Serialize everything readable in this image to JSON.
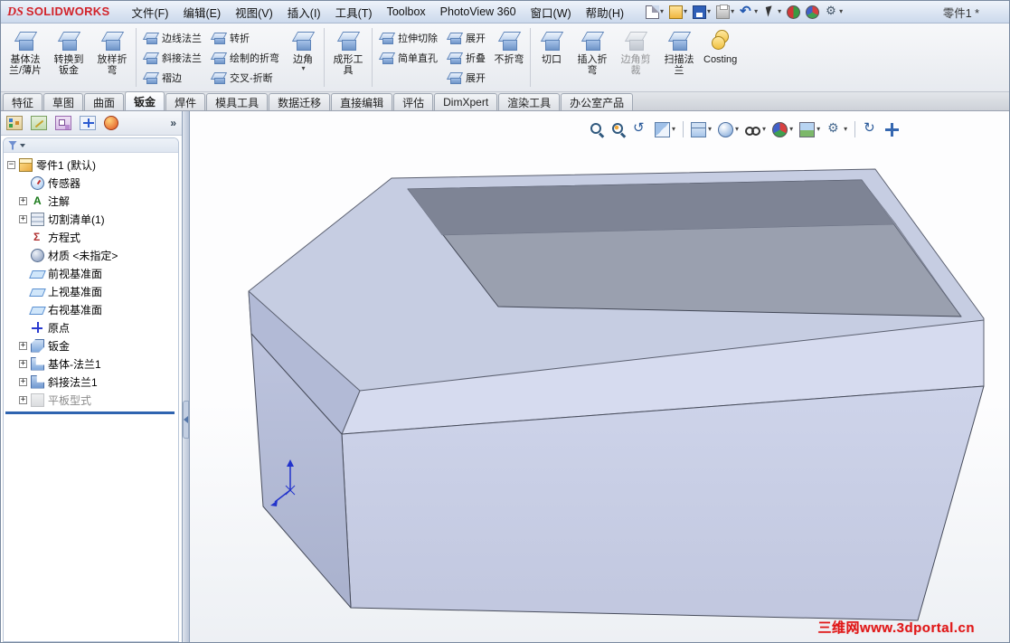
{
  "colors": {
    "brand_red": "#d2232a",
    "rollback_blue": "#2f64b0",
    "watermark_red": "#e01818",
    "model_face": "#c7cde5"
  },
  "titlebar": {
    "logo_ds": "DS",
    "logo_text": "SOLIDWORKS",
    "menus": [
      "文件(F)",
      "编辑(E)",
      "视图(V)",
      "插入(I)",
      "工具(T)",
      "Toolbox",
      "PhotoView 360",
      "窗口(W)",
      "帮助(H)"
    ],
    "doc_title": "零件1 *",
    "quick_tools": [
      {
        "name": "new",
        "dd": true
      },
      {
        "name": "open",
        "dd": true
      },
      {
        "name": "save",
        "dd": true
      },
      {
        "name": "print",
        "dd": true
      },
      {
        "name": "undo",
        "dd": true
      },
      {
        "name": "select",
        "dd": true
      },
      {
        "name": "rebuild",
        "dd": false
      },
      {
        "name": "appearance",
        "dd": false
      },
      {
        "name": "options",
        "dd": true
      }
    ]
  },
  "ribbon": {
    "items": [
      {
        "kind": "large",
        "label": "基体法兰/薄片",
        "icon": "base-flange"
      },
      {
        "kind": "large",
        "label": "转换到钣金",
        "icon": "convert-to-sheet-metal"
      },
      {
        "kind": "large",
        "label": "放样折弯",
        "icon": "lofted-bend"
      },
      {
        "kind": "sep"
      },
      {
        "kind": "col",
        "buttons": [
          {
            "label": "边线法兰",
            "icon": "edge-flange"
          },
          {
            "label": "斜接法兰",
            "icon": "miter-flange"
          },
          {
            "label": "褶边",
            "icon": "hem"
          }
        ]
      },
      {
        "kind": "col",
        "buttons": [
          {
            "label": "转折",
            "icon": "jog"
          },
          {
            "label": "绘制的折弯",
            "icon": "sketched-bend"
          },
          {
            "label": "交叉-折断",
            "icon": "cross-break"
          }
        ]
      },
      {
        "kind": "large",
        "label": "边角",
        "icon": "corner",
        "dd": true
      },
      {
        "kind": "sep"
      },
      {
        "kind": "large",
        "label": "成形工具",
        "icon": "forming-tool"
      },
      {
        "kind": "sep"
      },
      {
        "kind": "col",
        "buttons": [
          {
            "label": "拉伸切除",
            "icon": "extruded-cut"
          },
          {
            "label": "简单直孔",
            "icon": "simple-hole"
          }
        ]
      },
      {
        "kind": "col",
        "buttons": [
          {
            "label": "展开",
            "icon": "unfold"
          },
          {
            "label": "折叠",
            "icon": "fold"
          },
          {
            "label": "展开",
            "icon": "flatten"
          }
        ]
      },
      {
        "kind": "large",
        "label": "不折弯",
        "icon": "no-bends"
      },
      {
        "kind": "sep"
      },
      {
        "kind": "large",
        "label": "切口",
        "icon": "rip"
      },
      {
        "kind": "large",
        "label": "插入折弯",
        "icon": "insert-bends"
      },
      {
        "kind": "large",
        "label": "边角剪裁",
        "icon": "corner-trim",
        "disabled": true
      },
      {
        "kind": "large",
        "label": "扫描法兰",
        "icon": "swept-flange"
      },
      {
        "kind": "large",
        "label": "Costing",
        "icon": "costing"
      }
    ]
  },
  "tabs": {
    "items": [
      "特征",
      "草图",
      "曲面",
      "钣金",
      "焊件",
      "模具工具",
      "数据迁移",
      "直接编辑",
      "评估",
      "DimXpert",
      "渲染工具",
      "办公室产品"
    ],
    "active_index": 3
  },
  "feature_tree": {
    "panel_tabs": [
      "featuremanager",
      "propertymanager",
      "configurationmanager",
      "dimxpertmanager",
      "displaymanager"
    ],
    "chevron": "»",
    "items": [
      {
        "label": "零件1 (默认)",
        "icon": "part",
        "level": 0,
        "expander": "minus"
      },
      {
        "label": "传感器",
        "icon": "sensors",
        "level": 1
      },
      {
        "label": "注解",
        "icon": "annotations",
        "level": 1,
        "expander": "plus"
      },
      {
        "label": "切割清单(1)",
        "icon": "cut-list",
        "level": 1,
        "expander": "plus"
      },
      {
        "label": "方程式",
        "icon": "equations",
        "level": 1
      },
      {
        "label": "材质 <未指定>",
        "icon": "material",
        "level": 1
      },
      {
        "label": "前视基准面",
        "icon": "plane",
        "level": 1
      },
      {
        "label": "上视基准面",
        "icon": "plane",
        "level": 1
      },
      {
        "label": "右视基准面",
        "icon": "plane",
        "level": 1
      },
      {
        "label": "原点",
        "icon": "origin",
        "level": 1
      },
      {
        "label": "钣金",
        "icon": "sheet-metal",
        "level": 1,
        "expander": "plus"
      },
      {
        "label": "基体-法兰1",
        "icon": "base-flange",
        "level": 1,
        "expander": "plus"
      },
      {
        "label": "斜接法兰1",
        "icon": "miter-flange",
        "level": 1,
        "expander": "plus"
      },
      {
        "label": "平板型式",
        "icon": "flat-pattern",
        "level": 1,
        "expander": "plus",
        "disabled": true
      }
    ]
  },
  "viewport": {
    "watermark": "三维网www.3dportal.cn",
    "headsup_tools": [
      {
        "name": "zoom-fit"
      },
      {
        "name": "zoom-area"
      },
      {
        "name": "previous-view"
      },
      {
        "name": "section-view",
        "dd": true
      },
      {
        "sep": true
      },
      {
        "name": "view-orientation",
        "dd": true
      },
      {
        "name": "display-style",
        "dd": true
      },
      {
        "name": "hide-show-items",
        "dd": true
      },
      {
        "name": "edit-appearance",
        "dd": true
      },
      {
        "name": "apply-scene",
        "dd": true
      },
      {
        "name": "view-settings",
        "dd": true
      },
      {
        "sep": true
      },
      {
        "name": "rotate-view"
      },
      {
        "name": "pan"
      }
    ]
  }
}
